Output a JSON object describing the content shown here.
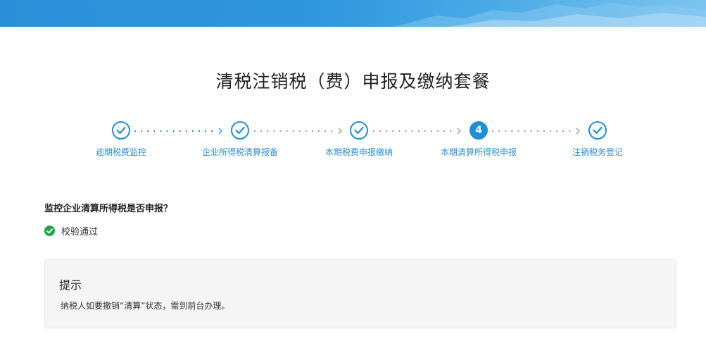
{
  "page": {
    "title": "清税注销税（费）申报及缴纳套餐"
  },
  "steps": [
    {
      "label": "逾期税费监控",
      "status": "done"
    },
    {
      "label": "企业所得税清算报备",
      "status": "done"
    },
    {
      "label": "本期税费申报缴纳",
      "status": "done"
    },
    {
      "label": "本期清算所得税申报",
      "status": "current",
      "number": "4"
    },
    {
      "label": "注销税务登记",
      "status": "done"
    }
  ],
  "check": {
    "question": "监控企业清算所得税是否申报？",
    "result": "校验通过"
  },
  "tip": {
    "title": "提示",
    "text": "纳税人如要撤销“清算”状态，需到前台办理。"
  },
  "colors": {
    "accent": "#1e90d6",
    "success": "#1aa548",
    "banner": "#2a8fd8"
  }
}
